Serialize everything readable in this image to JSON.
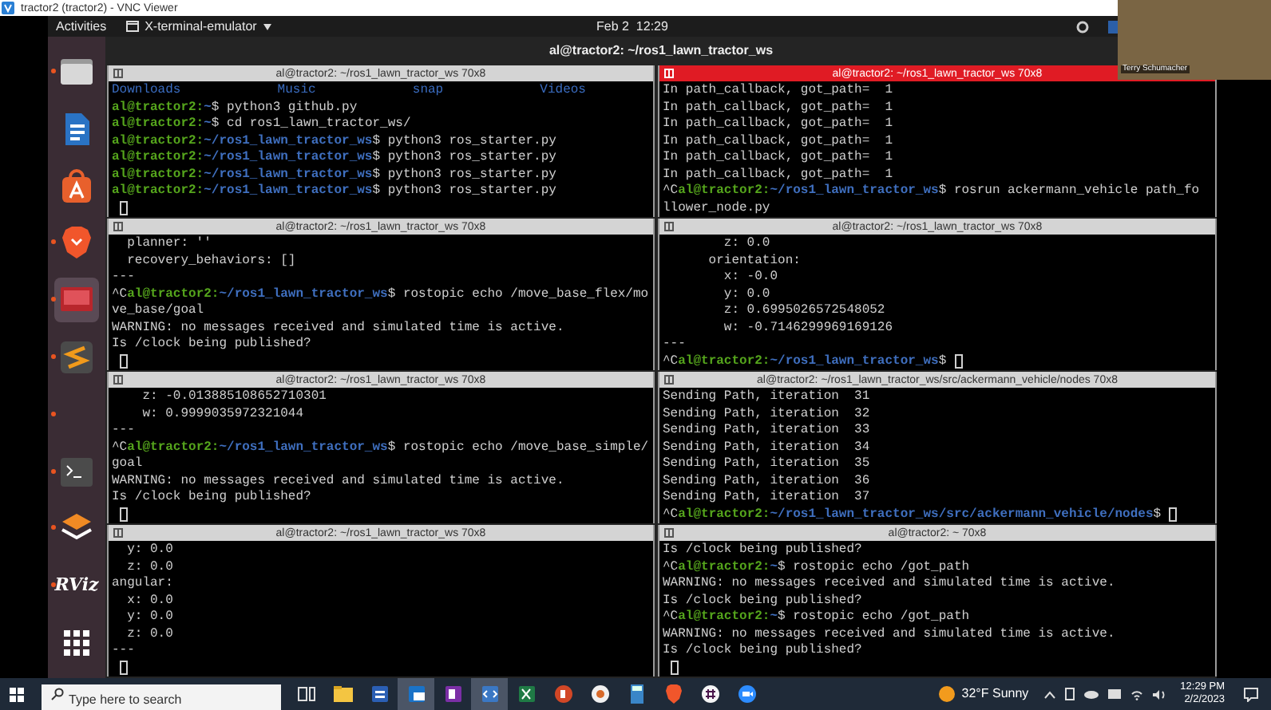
{
  "vnc_window": {
    "title": "tractor2 (tractor2) - VNC Viewer"
  },
  "top_bar": {
    "activities": "Activities",
    "app_menu": "X-terminal-emulator",
    "clock": "Feb 2  12:29"
  },
  "webcam": {
    "caption": "Terry Schumacher"
  },
  "dock": [
    {
      "kind": "files",
      "running": true,
      "selected": false
    },
    {
      "kind": "writer",
      "running": false,
      "selected": false
    },
    {
      "kind": "store",
      "running": false,
      "selected": false
    },
    {
      "kind": "brave",
      "running": true,
      "selected": false
    },
    {
      "kind": "monitor",
      "running": true,
      "selected": true
    },
    {
      "kind": "editor",
      "running": true,
      "selected": false
    },
    {
      "kind": "blank",
      "running": true,
      "selected": false
    },
    {
      "kind": "terminal",
      "running": true,
      "selected": false
    },
    {
      "kind": "layers",
      "running": true,
      "selected": false
    },
    {
      "kind": "label",
      "label": "RViz",
      "running": true,
      "selected": false
    },
    {
      "kind": "grid",
      "running": false,
      "selected": false
    }
  ],
  "window": {
    "title": "al@tractor2: ~/ros1_lawn_tractor_ws"
  },
  "terminals": [
    {
      "title": "al@tractor2: ~/ros1_lawn_tractor_ws 70x8",
      "selected": false,
      "lines": [
        {
          "kind": "dirs",
          "items": [
            "Downloads",
            "Music",
            "snap",
            "Videos"
          ]
        },
        {
          "kind": "prompt",
          "user": "al@tractor2:",
          "path": "~",
          "command": "$ python3 github.py"
        },
        {
          "kind": "prompt",
          "user": "al@tractor2:",
          "path": "~",
          "command": "$ cd ros1_lawn_tractor_ws/"
        },
        {
          "kind": "prompt",
          "user": "al@tractor2:",
          "path": "~/ros1_lawn_tractor_ws",
          "command": "$ python3 ros_starter.py"
        },
        {
          "kind": "prompt",
          "user": "al@tractor2:",
          "path": "~/ros1_lawn_tractor_ws",
          "command": "$ python3 ros_starter.py"
        },
        {
          "kind": "prompt",
          "user": "al@tractor2:",
          "path": "~/ros1_lawn_tractor_ws",
          "command": "$ python3 ros_starter.py"
        },
        {
          "kind": "prompt",
          "user": "al@tractor2:",
          "path": "~/ros1_lawn_tractor_ws",
          "command": "$ python3 ros_starter.py"
        },
        {
          "kind": "cursor"
        }
      ]
    },
    {
      "title": "al@tractor2: ~/ros1_lawn_tractor_ws 70x8",
      "selected": true,
      "lines": [
        {
          "kind": "text",
          "text": "In path_callback, got_path=  1"
        },
        {
          "kind": "text",
          "text": "In path_callback, got_path=  1"
        },
        {
          "kind": "text",
          "text": "In path_callback, got_path=  1"
        },
        {
          "kind": "text",
          "text": "In path_callback, got_path=  1"
        },
        {
          "kind": "text",
          "text": "In path_callback, got_path=  1"
        },
        {
          "kind": "text",
          "text": "In path_callback, got_path=  1"
        },
        {
          "kind": "prompt",
          "prefix": "^C",
          "user": "al@tractor2:",
          "path": "~/ros1_lawn_tractor_ws",
          "command": "$ rosrun ackermann_vehicle path_fo"
        },
        {
          "kind": "text",
          "text": "llower_node.py"
        }
      ]
    },
    {
      "title": "al@tractor2: ~/ros1_lawn_tractor_ws 70x8",
      "selected": false,
      "lines": [
        {
          "kind": "text",
          "text": "  planner: ''"
        },
        {
          "kind": "text",
          "text": "  recovery_behaviors: []"
        },
        {
          "kind": "text",
          "text": "---"
        },
        {
          "kind": "prompt",
          "prefix": "^C",
          "user": "al@tractor2:",
          "path": "~/ros1_lawn_tractor_ws",
          "command": "$ rostopic echo /move_base_flex/mo"
        },
        {
          "kind": "text",
          "text": "ve_base/goal"
        },
        {
          "kind": "text",
          "text": "WARNING: no messages received and simulated time is active."
        },
        {
          "kind": "text",
          "text": "Is /clock being published?"
        },
        {
          "kind": "cursor"
        }
      ]
    },
    {
      "title": "al@tractor2: ~/ros1_lawn_tractor_ws 70x8",
      "selected": false,
      "lines": [
        {
          "kind": "text",
          "text": "        z: 0.0"
        },
        {
          "kind": "text",
          "text": "      orientation:"
        },
        {
          "kind": "text",
          "text": "        x: -0.0"
        },
        {
          "kind": "text",
          "text": "        y: 0.0"
        },
        {
          "kind": "text",
          "text": "        z: 0.6995026572548052"
        },
        {
          "kind": "text",
          "text": "        w: -0.7146299969169126"
        },
        {
          "kind": "text",
          "text": "---"
        },
        {
          "kind": "prompt",
          "prefix": "^C",
          "user": "al@tractor2:",
          "path": "~/ros1_lawn_tractor_ws",
          "command": "$",
          "cursor": true
        }
      ]
    },
    {
      "title": "al@tractor2: ~/ros1_lawn_tractor_ws 70x8",
      "selected": false,
      "lines": [
        {
          "kind": "text",
          "text": "    z: -0.013885108652710301"
        },
        {
          "kind": "text",
          "text": "    w: 0.9999035972321044"
        },
        {
          "kind": "text",
          "text": "---"
        },
        {
          "kind": "prompt",
          "prefix": "^C",
          "user": "al@tractor2:",
          "path": "~/ros1_lawn_tractor_ws",
          "command": "$ rostopic echo /move_base_simple/"
        },
        {
          "kind": "text",
          "text": "goal"
        },
        {
          "kind": "text",
          "text": "WARNING: no messages received and simulated time is active."
        },
        {
          "kind": "text",
          "text": "Is /clock being published?"
        },
        {
          "kind": "cursor"
        }
      ]
    },
    {
      "title": "al@tractor2: ~/ros1_lawn_tractor_ws/src/ackermann_vehicle/nodes 70x8",
      "selected": false,
      "lines": [
        {
          "kind": "text",
          "text": "Sending Path, iteration  31"
        },
        {
          "kind": "text",
          "text": "Sending Path, iteration  32"
        },
        {
          "kind": "text",
          "text": "Sending Path, iteration  33"
        },
        {
          "kind": "text",
          "text": "Sending Path, iteration  34"
        },
        {
          "kind": "text",
          "text": "Sending Path, iteration  35"
        },
        {
          "kind": "text",
          "text": "Sending Path, iteration  36"
        },
        {
          "kind": "text",
          "text": "Sending Path, iteration  37"
        },
        {
          "kind": "prompt",
          "prefix": "^C",
          "user": "al@tractor2:",
          "path": "~/ros1_lawn_tractor_ws/src/ackermann_vehicle/nodes",
          "command": "$",
          "cursor": true
        }
      ]
    },
    {
      "title": "al@tractor2: ~/ros1_lawn_tractor_ws 70x8",
      "selected": false,
      "lines": [
        {
          "kind": "text",
          "text": "  y: 0.0"
        },
        {
          "kind": "text",
          "text": "  z: 0.0"
        },
        {
          "kind": "text",
          "text": "angular:"
        },
        {
          "kind": "text",
          "text": "  x: 0.0"
        },
        {
          "kind": "text",
          "text": "  y: 0.0"
        },
        {
          "kind": "text",
          "text": "  z: 0.0"
        },
        {
          "kind": "text",
          "text": "---"
        },
        {
          "kind": "cursor"
        }
      ]
    },
    {
      "title": "al@tractor2: ~ 70x8",
      "selected": false,
      "lines": [
        {
          "kind": "text",
          "text": "Is /clock being published?"
        },
        {
          "kind": "prompt",
          "prefix": "^C",
          "user": "al@tractor2:",
          "path": "~",
          "command": "$ rostopic echo /got_path"
        },
        {
          "kind": "text",
          "text": "WARNING: no messages received and simulated time is active."
        },
        {
          "kind": "text",
          "text": "Is /clock being published?"
        },
        {
          "kind": "prompt",
          "prefix": "^C",
          "user": "al@tractor2:",
          "path": "~",
          "command": "$ rostopic echo /got_path"
        },
        {
          "kind": "text",
          "text": "WARNING: no messages received and simulated time is active."
        },
        {
          "kind": "text",
          "text": "Is /clock being published?"
        },
        {
          "kind": "cursor"
        }
      ]
    }
  ],
  "taskbar": {
    "search": {
      "placeholder": "Type here to search"
    },
    "apps": [
      {
        "kind": "taskview",
        "selected": false
      },
      {
        "kind": "folder",
        "selected": false
      },
      {
        "kind": "word",
        "selected": false
      },
      {
        "kind": "outlook",
        "selected": true
      },
      {
        "kind": "onenote",
        "selected": false
      },
      {
        "kind": "vscode",
        "selected": true
      },
      {
        "kind": "excel",
        "selected": false
      },
      {
        "kind": "powerpoint",
        "selected": false
      },
      {
        "kind": "chrome",
        "selected": false
      },
      {
        "kind": "calculator",
        "selected": false
      },
      {
        "kind": "brave",
        "selected": false
      },
      {
        "kind": "slack",
        "selected": false
      },
      {
        "kind": "zoom",
        "selected": false
      }
    ],
    "weather": "32°F Sunny",
    "time": "12:29 PM",
    "date": "2/2/2023"
  }
}
